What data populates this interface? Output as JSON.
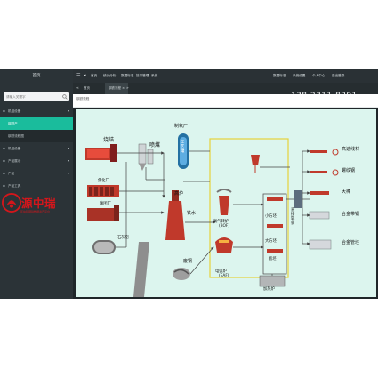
{
  "sidebar": {
    "title": "首页",
    "search_placeholder": "请输入关键字",
    "items": [
      {
        "label": "机组设备"
      },
      {
        "label": "钢铁产"
      },
      {
        "label": "钢铁流程图"
      },
      {
        "label": "机组设备"
      },
      {
        "label": "产品展示"
      },
      {
        "label": "产品"
      },
      {
        "label": "产品工具"
      }
    ],
    "logo": {
      "name": "源中瑞",
      "tagline": "区块链钢铁数据资产平台"
    }
  },
  "topbar": {
    "items": [
      "首页",
      "统计分析",
      "数据标准",
      "接口管理",
      "系统"
    ],
    "right": [
      "数据标准",
      "系统设置",
      "个人中心",
      "退出登录"
    ]
  },
  "tabbar": {
    "items": [
      "首页",
      "钢铁流程"
    ]
  },
  "phone": "138-2311-8291",
  "breadcrumb": "钢铁流程",
  "diagram": {
    "labels": {
      "sinter": "烧结",
      "coal_injection": "喷煤",
      "oxygen_plant": "制氧厂",
      "coke_plant": "焦化厂",
      "pellet_plant": "球团厂",
      "limestone": "石灰窑",
      "blast_furnace": "高炉",
      "molten_iron": "铁水",
      "scrap": "废钢",
      "bof": "氧气转炉",
      "bof_en": "(BOF)",
      "eaf": "电弧炉",
      "eaf_en": "(EAF)",
      "gas_tank": "工艺罐",
      "small_billet": "小方坯",
      "big_billet": "大方坯",
      "slab": "板坯",
      "hot_rolling": "直接轧钢",
      "reheating": "加热炉",
      "high_speed_wire": "高速线材",
      "rebar": "螺纹钢",
      "bar": "大棒",
      "alloy_strip": "合金带钢",
      "alloy_pipe": "合金管坯"
    }
  },
  "colors": {
    "accent": "#1abc9c",
    "brand_red": "#d4161b",
    "canvas": "#dcf5ee",
    "highlight_box": "#e5d23a"
  }
}
